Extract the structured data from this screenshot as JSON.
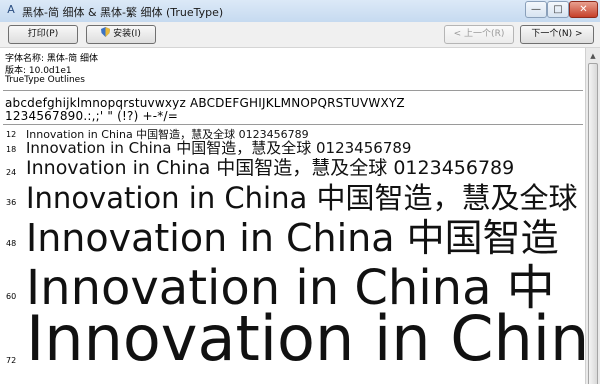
{
  "window": {
    "title": "黑体-简 细体 & 黑体-繁 细体 (TrueType)",
    "buttons": {
      "minimize": "—",
      "maximize": "□",
      "close": "✕"
    }
  },
  "toolbar": {
    "print_label": "打印(P)",
    "install_label": "安装(I)",
    "prev_label": "< 上一个(R)",
    "next_label": "下一个(N) >"
  },
  "info": {
    "font_name": "字体名称: 黑体-简 细体",
    "version": "版本: 10.0d1e1",
    "outline": "TrueType Outlines"
  },
  "charset": {
    "line1": "abcdefghijklmnopqrstuvwxyz ABCDEFGHIJKLMNOPQRSTUVWXYZ",
    "line2": "1234567890.:,;' \" (!?) +-*/="
  },
  "samples": [
    {
      "size": "12",
      "text": "Innovation in China 中国智造，慧及全球 0123456789"
    },
    {
      "size": "18",
      "text": "Innovation in China 中国智造，慧及全球 0123456789"
    },
    {
      "size": "24",
      "text": "Innovation in China 中国智造，慧及全球 0123456789"
    },
    {
      "size": "36",
      "text": "Innovation in China 中国智造，慧及全球"
    },
    {
      "size": "48",
      "text": "Innovation in China 中国智造"
    },
    {
      "size": "60",
      "text": "Innovation in China 中"
    },
    {
      "size": "72",
      "text": "Innovation in Chin"
    }
  ],
  "icons": {
    "app": "font-viewer-icon",
    "install": "shield-icon",
    "scroll_up": "scroll-up-arrow-icon"
  }
}
